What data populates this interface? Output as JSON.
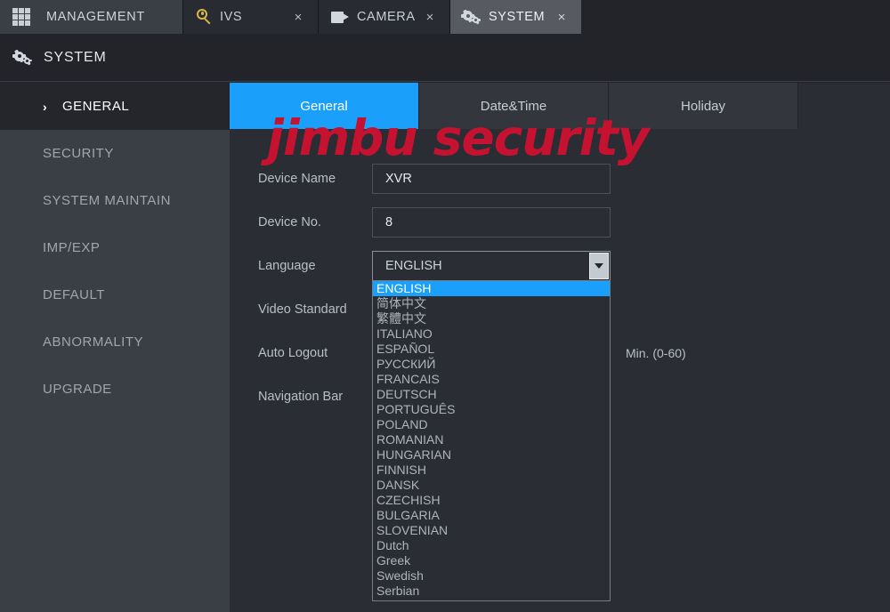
{
  "topbar": {
    "management_label": "MANAGEMENT",
    "grid_icon": "grid-icon",
    "tabs": [
      {
        "label": "IVS",
        "icon": "ivs-magnifier-icon",
        "close": "×",
        "active": false
      },
      {
        "label": "CAMERA",
        "icon": "camcorder-icon",
        "close": "×",
        "active": false
      },
      {
        "label": "SYSTEM",
        "icon": "gears-icon",
        "close": "×",
        "active": true
      }
    ]
  },
  "page_header": {
    "icon": "gears-icon",
    "title": "SYSTEM"
  },
  "sidebar": {
    "items": [
      {
        "label": "GENERAL",
        "active": true,
        "chevron": "›"
      },
      {
        "label": "SECURITY",
        "active": false
      },
      {
        "label": "SYSTEM MAINTAIN",
        "active": false
      },
      {
        "label": "IMP/EXP",
        "active": false
      },
      {
        "label": "DEFAULT",
        "active": false
      },
      {
        "label": "ABNORMALITY",
        "active": false
      },
      {
        "label": "UPGRADE",
        "active": false
      }
    ]
  },
  "content": {
    "subtabs": [
      {
        "label": "General",
        "active": true
      },
      {
        "label": "Date&Time",
        "active": false
      },
      {
        "label": "Holiday",
        "active": false
      }
    ],
    "form": {
      "device_name_label": "Device Name",
      "device_name_value": "XVR",
      "device_no_label": "Device No.",
      "device_no_value": "8",
      "language_label": "Language",
      "language_value": "ENGLISH",
      "video_standard_label": "Video Standard",
      "auto_logout_label": "Auto Logout",
      "auto_logout_hint": "Min. (0-60)",
      "navigation_bar_label": "Navigation Bar"
    },
    "language_options": [
      "ENGLISH",
      "简体中文",
      "繁體中文",
      "ITALIANO",
      "ESPAÑOL",
      "РУССКИЙ",
      "FRANCAIS",
      "DEUTSCH",
      "PORTUGUÊS",
      "POLAND",
      "ROMANIAN",
      "HUNGARIAN",
      "FINNISH",
      "DANSK",
      "CZECHISH",
      "BULGARIA",
      "SLOVENIAN",
      "Dutch",
      "Greek",
      "Swedish",
      "Serbian"
    ],
    "selected_language_index": 0
  },
  "watermark": {
    "text": "jimbu security",
    "color": "#c41230"
  },
  "colors": {
    "accent_blue": "#1a9ffa",
    "background": "#2a2d33",
    "sidebar": "#3a3e45",
    "active_sidebar": "#24262b",
    "topbar_active_tab": "#575b61"
  }
}
